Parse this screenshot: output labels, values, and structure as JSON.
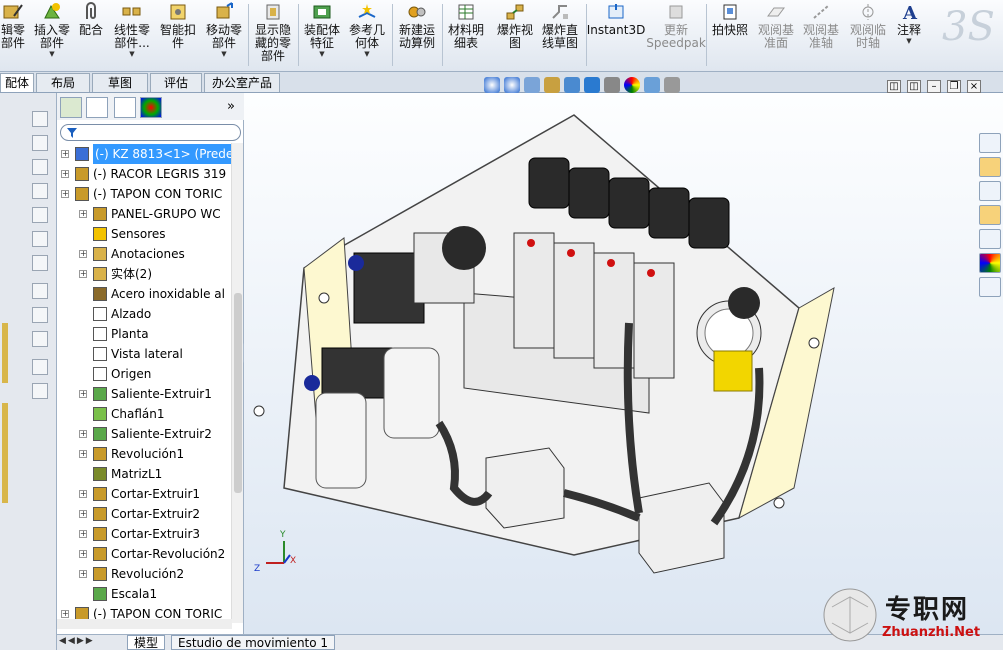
{
  "ribbon": {
    "items": [
      {
        "label": "辑零\n部件"
      },
      {
        "label": "插入零\n部件"
      },
      {
        "label": "配合"
      },
      {
        "label": "线性零\n部件..."
      },
      {
        "label": "智能扣\n件"
      },
      {
        "label": "移动零\n部件"
      },
      {
        "label": "显示隐\n藏的零\n部件"
      },
      {
        "label": "装配体\n特征"
      },
      {
        "label": "参考几\n何体"
      },
      {
        "label": "新建运\n动算例"
      },
      {
        "label": "材料明\n细表"
      },
      {
        "label": "爆炸视\n图"
      },
      {
        "label": "爆炸直\n线草图"
      },
      {
        "label": "Instant3D"
      },
      {
        "label": "更新\nSpeedpak"
      },
      {
        "label": "拍快照"
      },
      {
        "label": "观阅基\n准面"
      },
      {
        "label": "观阅基\n准轴"
      },
      {
        "label": "观阅临\n时轴"
      },
      {
        "label": "注释"
      }
    ]
  },
  "tabs": [
    "配体",
    "布局",
    "草图",
    "评估",
    "办公室产品"
  ],
  "tree": {
    "rows": [
      {
        "label": "(-) KZ 8813<1> (Prede",
        "selected": true
      },
      {
        "label": "(-) RACOR LEGRIS 319"
      },
      {
        "label": "(-) TAPON CON TORIC"
      },
      {
        "label": "PANEL-GRUPO WC"
      },
      {
        "label": "Sensores"
      },
      {
        "label": "Anotaciones"
      },
      {
        "label": "实体(2)"
      },
      {
        "label": "Acero inoxidable al"
      },
      {
        "label": "Alzado"
      },
      {
        "label": "Planta"
      },
      {
        "label": "Vista lateral"
      },
      {
        "label": "Origen"
      },
      {
        "label": "Saliente-Extruir1"
      },
      {
        "label": "Chaflán1"
      },
      {
        "label": "Saliente-Extruir2"
      },
      {
        "label": "Revolución1"
      },
      {
        "label": "MatrizL1"
      },
      {
        "label": "Cortar-Extruir1"
      },
      {
        "label": "Cortar-Extruir2"
      },
      {
        "label": "Cortar-Extruir3"
      },
      {
        "label": "Cortar-Revolución2"
      },
      {
        "label": "Revolución2"
      },
      {
        "label": "Escala1"
      },
      {
        "label": "(-) TAPON CON TORIC"
      }
    ]
  },
  "bottom_tabs": [
    "模型",
    "Estudio de movimiento 1"
  ],
  "triad": {
    "x": "X",
    "y": "Y",
    "z": "Z"
  },
  "watermark": {
    "title": "专职网",
    "url": "Zhuanzhi.Net"
  },
  "colors": {
    "accent": "#3399ff",
    "ribbon_bg": "#e8edf4"
  }
}
